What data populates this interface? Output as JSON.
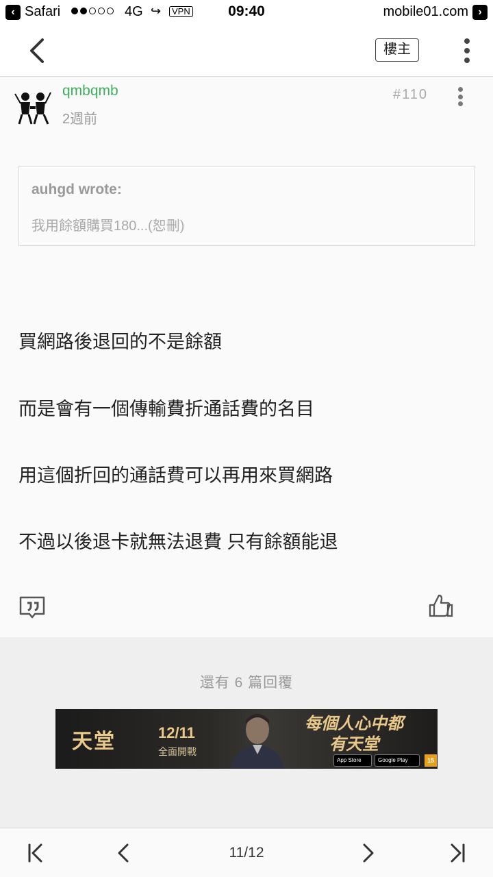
{
  "status_bar": {
    "back_app": "Safari",
    "network": "4G",
    "vpn": "VPN",
    "time": "09:40",
    "host": "mobile01.com"
  },
  "nav": {
    "op_label": "樓主"
  },
  "post": {
    "username": "qmbqmb",
    "time_ago": "2週前",
    "floor": "#110",
    "quote": {
      "author": "auhgd wrote:",
      "text": "我用餘額購買180...(恕刪)"
    },
    "body": [
      "買網路後退回的不是餘額",
      "而是會有一個傳輸費折通話費的名目",
      "用這個折回的通話費可以再用來買網路",
      "不過以後退卡就無法退費 只有餘額能退"
    ]
  },
  "more": {
    "text": "還有 6 篇回覆"
  },
  "ad": {
    "title": "天堂",
    "date": "12/11",
    "sub": "全面開戰",
    "slogan": "每個人心中都有天堂",
    "app_store": "App Store",
    "google_play": "Google Play",
    "rating": "15"
  },
  "pager": {
    "page": "11/12"
  }
}
